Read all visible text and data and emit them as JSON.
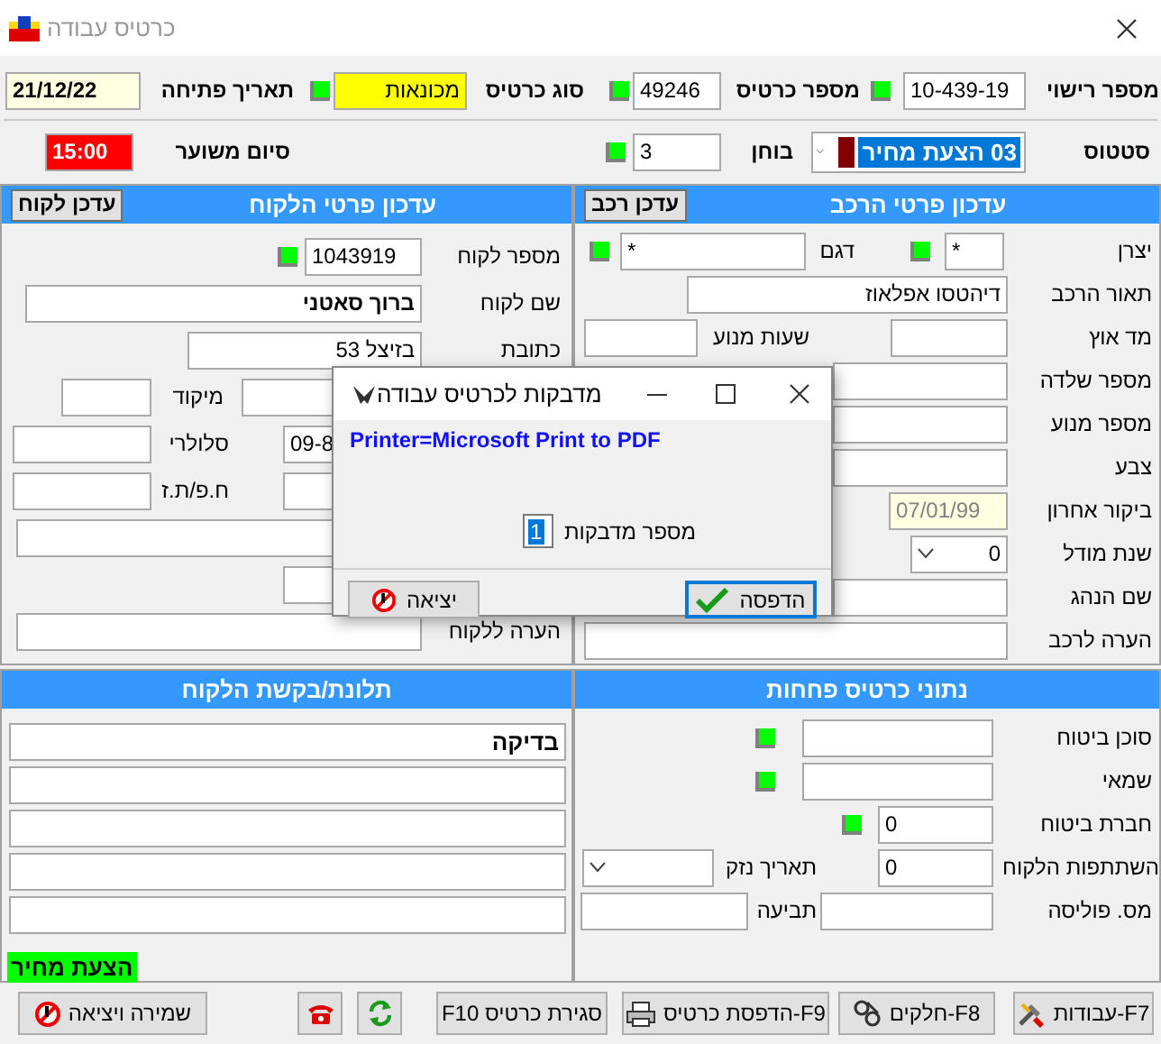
{
  "window": {
    "title": "כרטיס עבודה"
  },
  "header_rows": [
    [
      {
        "kind": "label",
        "text": "מספר רישוי"
      },
      {
        "kind": "field",
        "value": "10-439-19"
      },
      {
        "kind": "lookup"
      },
      {
        "kind": "label",
        "text": "מספר כרטיס"
      },
      {
        "kind": "field",
        "value": "49246"
      },
      {
        "kind": "lookup"
      },
      {
        "kind": "label",
        "text": "סוג כרטיס"
      },
      {
        "kind": "type_field",
        "value": "מכונאות"
      },
      {
        "kind": "lookup"
      },
      {
        "kind": "label",
        "text": "תאריך פתיחה"
      },
      {
        "kind": "date_field",
        "value": "21/12/22"
      }
    ],
    [
      {
        "kind": "label",
        "text": "סטטוס"
      },
      {
        "kind": "status_combo",
        "value": "03 הצעת מחיר",
        "color": "#800000"
      },
      {
        "kind": "label",
        "text": "בוחן"
      },
      {
        "kind": "field",
        "value": "3"
      },
      {
        "kind": "lookup"
      },
      {
        "kind": "label",
        "text": "סיום משוער"
      },
      {
        "kind": "alert_field",
        "value": "15:00"
      }
    ]
  ],
  "vehicle_panel": {
    "title": "עדכון פרטי הרכב",
    "update_button": "עדכן רכב",
    "rows": [
      [
        {
          "kind": "label",
          "text": "יצרן"
        },
        {
          "kind": "field",
          "value": "*"
        },
        {
          "kind": "lookup"
        },
        {
          "kind": "label",
          "text": "דגם"
        },
        {
          "kind": "field",
          "value": "*"
        },
        {
          "kind": "lookup"
        }
      ],
      [
        {
          "kind": "label",
          "text": "תאור הרכב"
        },
        {
          "kind": "field",
          "value": "דיהטסו אפלאוז"
        }
      ],
      [
        {
          "kind": "label",
          "text": "מד אוץ"
        },
        {
          "kind": "field"
        },
        {
          "kind": "label",
          "text": "שעות מנוע"
        },
        {
          "kind": "field"
        }
      ],
      [
        {
          "kind": "label",
          "text": "מספר שלדה"
        },
        {
          "kind": "field"
        }
      ],
      [
        {
          "kind": "label",
          "text": "מספר מנוע"
        },
        {
          "kind": "field"
        }
      ],
      [
        {
          "kind": "label",
          "text": "צבע"
        },
        {
          "kind": "field"
        }
      ],
      [
        {
          "kind": "label",
          "text": "ביקור אחרון"
        },
        {
          "kind": "readonly_field",
          "value": "07/01/99"
        }
      ],
      [
        {
          "kind": "label",
          "text": "שנת מודל"
        },
        {
          "kind": "combo",
          "value": "0"
        }
      ],
      [
        {
          "kind": "label",
          "text": "שם הנהג"
        },
        {
          "kind": "field"
        }
      ],
      [
        {
          "kind": "label",
          "text": "הערה לרכב"
        },
        {
          "kind": "field"
        }
      ]
    ]
  },
  "customer_panel": {
    "title": "עדכון פרטי הלקוח",
    "update_button": "עדכן לקוח",
    "rows": [
      [
        {
          "kind": "label",
          "text": "מספר לקוח"
        },
        {
          "kind": "field",
          "value": "1043919"
        },
        {
          "kind": "lookup"
        }
      ],
      [
        {
          "kind": "label",
          "text": "שם לקוח"
        },
        {
          "kind": "bold_field",
          "value": "ברוך סאטני"
        }
      ],
      [
        {
          "kind": "label",
          "text": "כתובת"
        },
        {
          "kind": "field",
          "value": "בזיצל 53"
        }
      ],
      [
        {
          "kind": "field"
        },
        {
          "kind": "label",
          "text": "מיקוד"
        },
        {
          "kind": "field"
        }
      ],
      [
        {
          "kind": "field",
          "value": "09-8"
        },
        {
          "kind": "label",
          "text": "סלולרי"
        },
        {
          "kind": "field"
        }
      ],
      [
        {
          "kind": "field"
        },
        {
          "kind": "label",
          "text": "ח.פ/ת.ז"
        },
        {
          "kind": "field"
        }
      ],
      [
        {
          "kind": "field"
        }
      ],
      [
        {
          "kind": "field"
        }
      ],
      [
        {
          "kind": "label",
          "text": "הערה ללקוח"
        },
        {
          "kind": "field"
        }
      ]
    ]
  },
  "bodywork_panel": {
    "title": "נתוני כרטיס פחחות",
    "rows": [
      [
        {
          "kind": "label",
          "text": "סוכן ביטוח"
        },
        {
          "kind": "field"
        },
        {
          "kind": "lookup"
        }
      ],
      [
        {
          "kind": "label",
          "text": "שמאי"
        },
        {
          "kind": "field"
        },
        {
          "kind": "lookup"
        }
      ],
      [
        {
          "kind": "label",
          "text": "חברת ביטוח"
        },
        {
          "kind": "field",
          "value": "0"
        },
        {
          "kind": "lookup"
        }
      ],
      [
        {
          "kind": "label",
          "text": "השתתפות הלקוח"
        },
        {
          "kind": "field",
          "value": "0"
        },
        {
          "kind": "label",
          "text": "תאריך נזק"
        },
        {
          "kind": "combo"
        }
      ],
      [
        {
          "kind": "label",
          "text": "מס. פוליסה"
        },
        {
          "kind": "field"
        },
        {
          "kind": "label",
          "text": "תביעה"
        },
        {
          "kind": "field"
        }
      ]
    ]
  },
  "complaint_panel": {
    "title": "תלונת/בקשת הלקוח",
    "lines": [
      "בדיקה"
    ],
    "status_tag": "הצעת מחיר"
  },
  "toolbar": [
    {
      "kind": "button",
      "label": "F7-עבודות"
    },
    {
      "kind": "button",
      "label": "F8-חלקים"
    },
    {
      "kind": "button",
      "label": "F9-הדפסת כרטיס"
    },
    {
      "kind": "button",
      "label": "סגירת כרטיס F10"
    },
    {
      "kind": "refresh"
    },
    {
      "kind": "phone"
    },
    {
      "kind": "button",
      "label": "שמירה ויציאה"
    }
  ],
  "dialog": {
    "title": "מדבקות לכרטיס עבודה",
    "printer": "Printer=Microsoft Print to PDF",
    "count_label": "מספר מדבקות",
    "count_value": "1",
    "buttons": [
      {
        "label": "הדפסה",
        "default": true
      },
      {
        "label": "יציאה",
        "default": false
      }
    ]
  }
}
